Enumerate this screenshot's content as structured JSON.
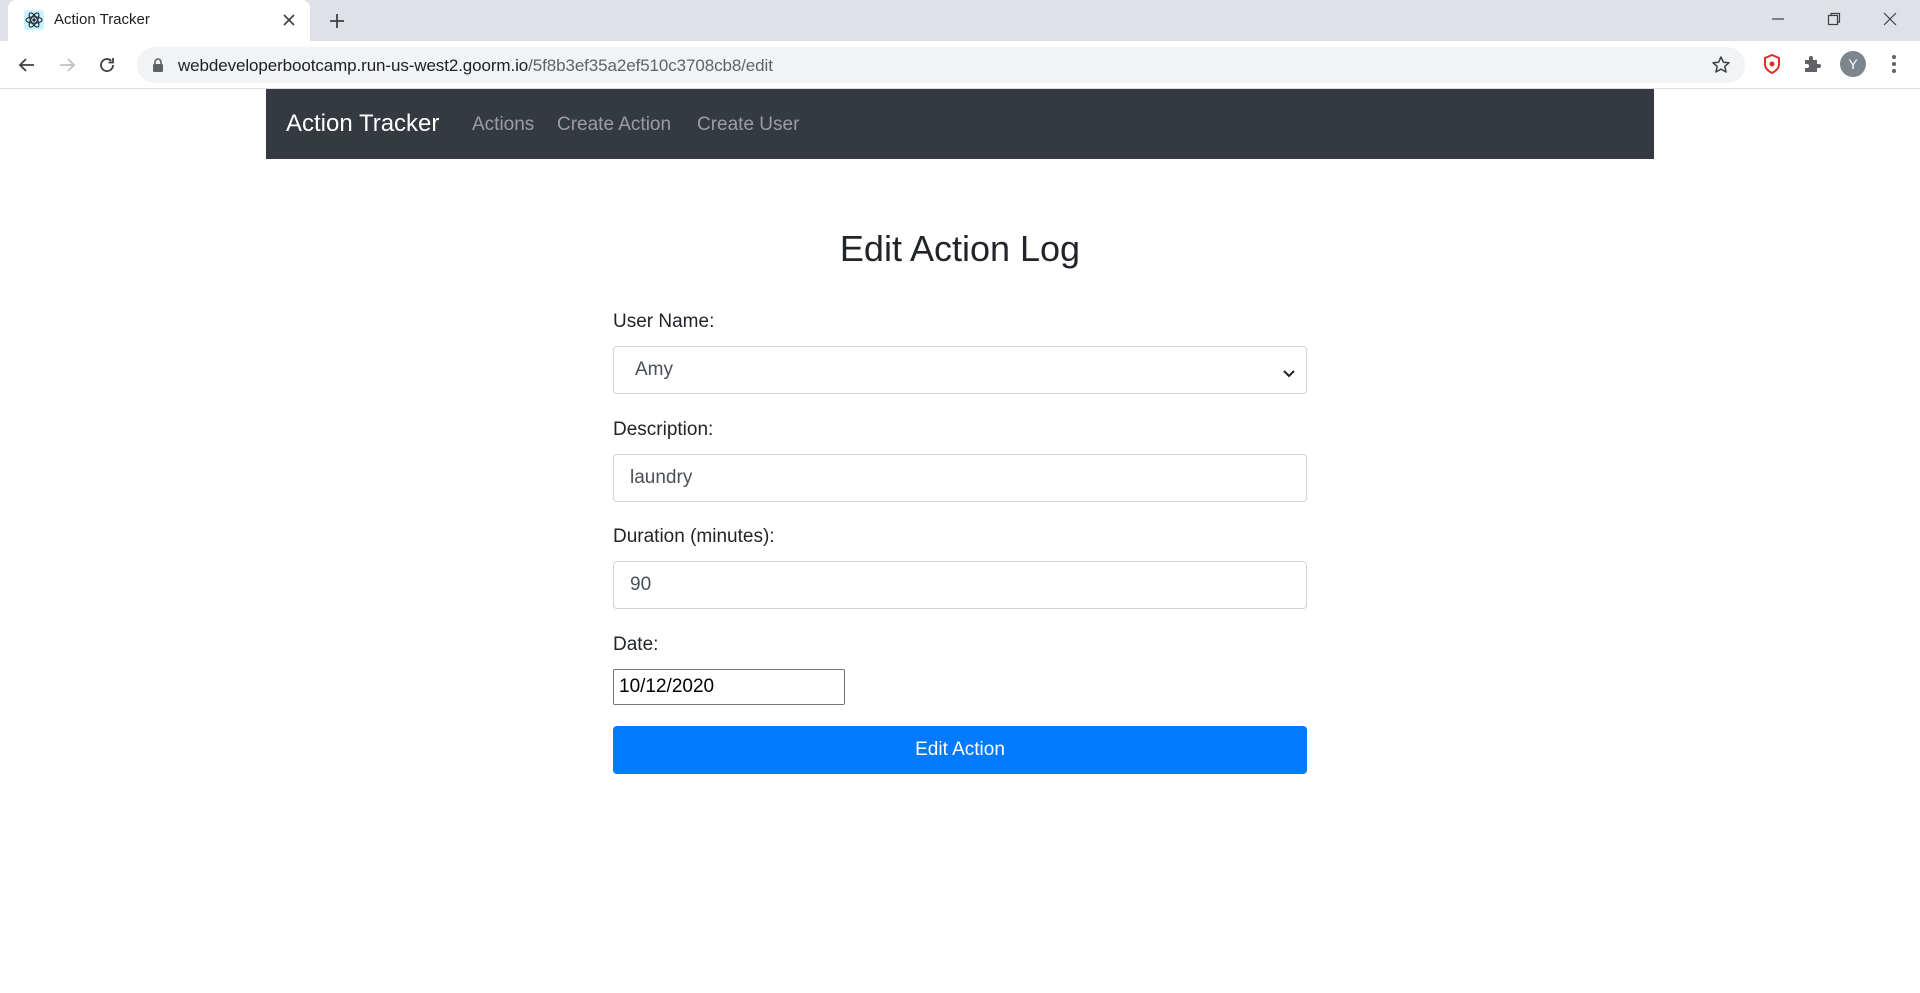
{
  "browser": {
    "tab_title": "Action Tracker",
    "url_host": "webdeveloperbootcamp.run-us-west2.goorm.io",
    "url_path": "/5f8b3ef35a2ef510c3708cb8/edit",
    "profile_initial": "Y"
  },
  "navbar": {
    "brand": "Action Tracker",
    "links": [
      "Actions",
      "Create Action",
      "Create User"
    ]
  },
  "form": {
    "title": "Edit Action Log",
    "username_label": "User Name:",
    "username_value": "Amy",
    "description_label": "Description:",
    "description_value": "laundry",
    "duration_label": "Duration (minutes):",
    "duration_value": "90",
    "date_label": "Date:",
    "date_value": "10/12/2020",
    "submit_label": "Edit Action"
  },
  "colors": {
    "navbar_bg": "#343a40",
    "primary": "#007bff",
    "chrome_tabbar": "#dee1e6"
  }
}
